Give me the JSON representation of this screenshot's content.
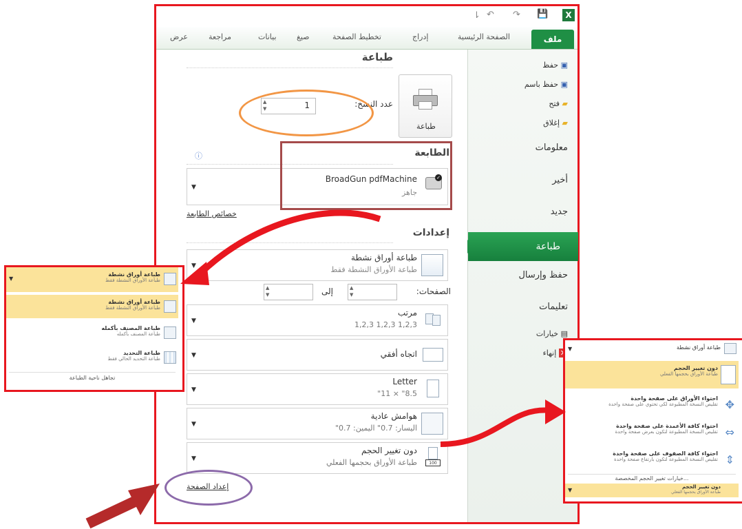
{
  "quick_access": {
    "undo": "↶",
    "redo": "↷",
    "save": "💾",
    "excel": "X"
  },
  "ribbon_tabs": {
    "file": "ملف",
    "home": "الصفحة الرئيسية",
    "insert": "إدراج",
    "page_layout": "تخطيط الصفحة",
    "formulas": "صيغ",
    "data": "بيانات",
    "review": "مراجعة",
    "view": "عرض"
  },
  "nav": {
    "save": "حفظ",
    "save_as": "حفظ باسم",
    "open": "فتح",
    "close": "إغلاق",
    "info": "معلومات",
    "recent": "أخير",
    "new": "جديد",
    "print": "طباعة",
    "save_send": "حفظ وإرسال",
    "help": "تعليمات",
    "options": "خيارات",
    "exit": "إنهاء"
  },
  "print": {
    "title": "طباعة",
    "button": "طباعة",
    "copies_label": "عدد النسخ:",
    "copies_value": "1",
    "printer_section": "الطابعة",
    "printer_name": "BroadGun pdfMachine",
    "printer_status": "جاهز",
    "printer_properties": "خصائص الطابعة",
    "settings_section": "إعدادات",
    "print_what_t1": "طباعة أوراق نشطة",
    "print_what_t2": "طباعة الأوراق النشطة فقط",
    "pages_label": "الصفحات:",
    "to_label": "إلى",
    "collate_t1": "مرتب",
    "collate_t2": "1,2,3   1,2,3   1,2,3",
    "orientation_t1": "اتجاه أفقي",
    "paper_t1": "Letter",
    "paper_t2": "8.5\" × 11\"",
    "margins_t1": "هوامش عادية",
    "margins_t2": "اليسار: 0.7\"   اليمين: 0.7\"",
    "scaling_t1": "دون تغيير الحجم",
    "scaling_t2": "طباعة الأوراق بحجمها الفعلي",
    "page_setup": "إعداد الصفحة"
  },
  "left_popup": {
    "header_t1": "طباعة أوراق نشطة",
    "header_t2": "طباعة الأوراق النشطة فقط",
    "items": [
      {
        "t1": "طباعة أوراق نشطة",
        "t2": "طباعة الأوراق النشطة فقط"
      },
      {
        "t1": "طباعة المصنف بأكمله",
        "t2": "طباعة المصنف بأكمله"
      },
      {
        "t1": "طباعة التحديد",
        "t2": "طباعة التحديد الحالي فقط"
      }
    ],
    "footer": "تجاهل ناحية الطباعة"
  },
  "right_popup": {
    "header_t1": "طباعة أوراق نشطة",
    "items": [
      {
        "t1": "دون تغيير الحجم",
        "t2": "طباعة الأوراق بحجمها الفعلي"
      },
      {
        "t1": "احتواء الأوراق على صفحة واحدة",
        "t2": "تقليص النسخة المطبوعة لكي تحتوي على صفحة واحدة"
      },
      {
        "t1": "احتواء كافة الأعمدة على صفحة واحدة",
        "t2": "تقليص النسخة المطبوعة لتكون بعرض صفحة واحدة"
      },
      {
        "t1": "احتواء كافة الصفوف على صفحة واحدة",
        "t2": "تقليص النسخة المطبوعة لتكون بارتفاع صفحة واحدة"
      }
    ],
    "footer": "خيارات تغيير الحجم المخصصة...",
    "bottom_t1": "دون تغيير الحجم",
    "bottom_t2": "طباعة الأوراق بحجمها الفعلي"
  }
}
